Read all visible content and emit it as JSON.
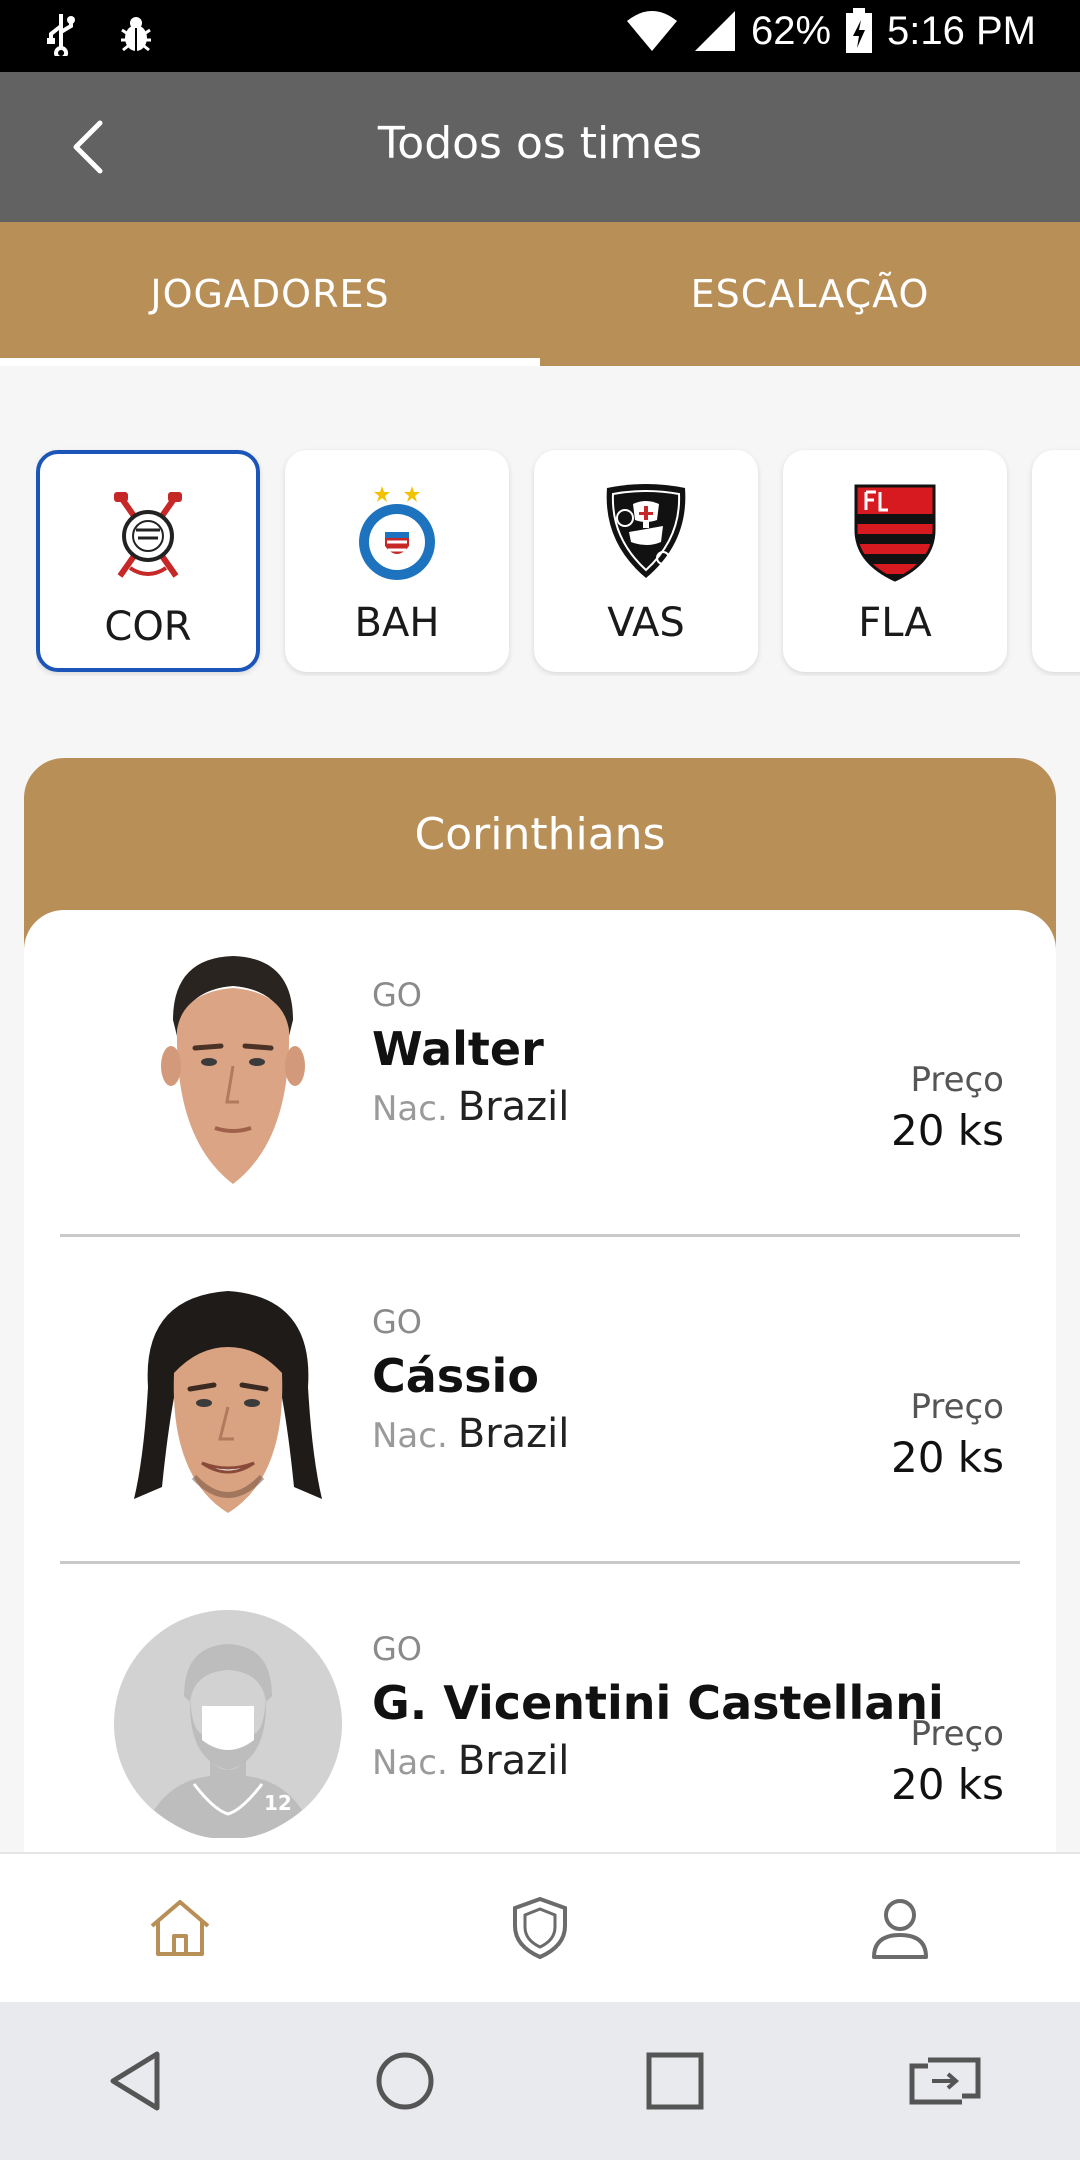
{
  "status_bar": {
    "battery": "62%",
    "time": "5:16 PM"
  },
  "app_bar": {
    "title": "Todos os times"
  },
  "tabs": [
    {
      "label": "JOGADORES",
      "active": true
    },
    {
      "label": "ESCALAÇÃO",
      "active": false
    }
  ],
  "teams": [
    {
      "abbr": "COR",
      "selected": true
    },
    {
      "abbr": "BAH",
      "selected": false
    },
    {
      "abbr": "VAS",
      "selected": false
    },
    {
      "abbr": "FLA",
      "selected": false
    }
  ],
  "roster": {
    "team_name": "Corinthians",
    "players": [
      {
        "position": "GO",
        "name": "Walter",
        "nat_label": "Nac.",
        "nationality": "Brazil",
        "price_label": "Preço",
        "price": "20 ks"
      },
      {
        "position": "GO",
        "name": "Cássio",
        "nat_label": "Nac.",
        "nationality": "Brazil",
        "price_label": "Preço",
        "price": "20 ks"
      },
      {
        "position": "GO",
        "name": "G. Vicentini Castellani",
        "nat_label": "Nac.",
        "nationality": "Brazil",
        "price_label": "Preço",
        "price": "20 ks",
        "placeholder_number": "12"
      }
    ]
  },
  "colors": {
    "app_bar": "#626262",
    "accent": "#b98f58",
    "selected_border": "#1c55b8",
    "home_icon_active": "#b98f58"
  }
}
